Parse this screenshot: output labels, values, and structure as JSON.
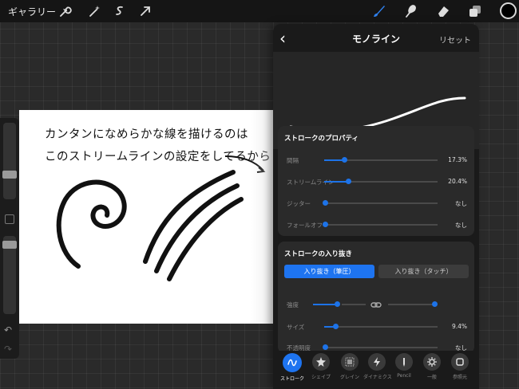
{
  "topbar": {
    "gallery_label": "ギャラリー",
    "tools": [
      "wrench-icon",
      "magic-wand-icon",
      "selection-icon",
      "transform-arrow-icon",
      "brush-icon",
      "smudge-icon",
      "eraser-icon",
      "layers-icon"
    ],
    "active_tool_color": "#2f80ed",
    "current_color": "#000000"
  },
  "canvas": {
    "note_line1": "カンタンになめらかな線を描けるのは",
    "note_line2": "このストリームラインの設定をしてるから",
    "arrow_symbol": "→"
  },
  "panel": {
    "title": "モノライン",
    "back_symbol": "‹",
    "reset_label": "リセット",
    "stroke_properties": {
      "title": "ストロークのプロパティ",
      "rows": [
        {
          "label": "間隔",
          "value": "17.3%",
          "level": 0.173
        },
        {
          "label": "ストリームライン",
          "value": "20.4%",
          "level": 0.204
        },
        {
          "label": "ジッター",
          "value": "なし",
          "level": 0
        },
        {
          "label": "フォールオフ",
          "value": "なし",
          "level": 0
        }
      ]
    },
    "taper": {
      "title": "ストロークの入り抜き",
      "segments": [
        "入り抜き（筆圧）",
        "入り抜き（タッチ）"
      ],
      "selected_segment": "入り抜き（筆圧）",
      "strength_label": "強度",
      "size_label": "サイズ",
      "size_value": "9.4%",
      "opacity_label": "不透明度",
      "opacity_value": "なし"
    },
    "tabs": [
      {
        "label": "ストローク",
        "icon": "stroke-path-icon",
        "active": true
      },
      {
        "label": "シェイプ",
        "icon": "shape-icon",
        "active": false
      },
      {
        "label": "グレイン",
        "icon": "grain-icon",
        "active": false
      },
      {
        "label": "ダイナミクス",
        "icon": "dynamics-icon",
        "active": false
      },
      {
        "label": "Pencil",
        "icon": "pencil-icon",
        "active": false
      },
      {
        "label": "一般",
        "icon": "general-icon",
        "active": false
      },
      {
        "label": "参照元",
        "icon": "source-icon",
        "active": false
      }
    ]
  }
}
